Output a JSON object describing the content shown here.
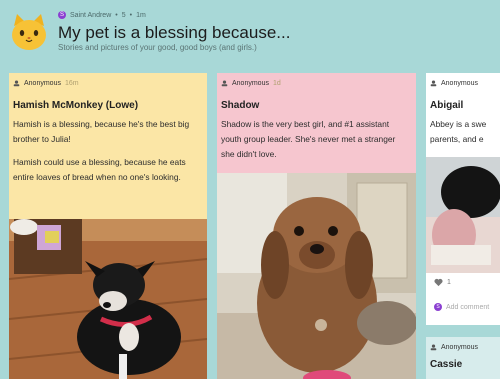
{
  "header": {
    "author": "Saint Andrew",
    "author_initial": "S",
    "likes": "5",
    "age": "1m",
    "title": "My pet is a blessing because...",
    "subtitle": "Stories and pictures of your good, good boys (and girls.)"
  },
  "posts": [
    {
      "author": "Anonymous",
      "time": "16m",
      "title": "Hamish McMonkey (Lowe)",
      "body": [
        "Hamish is a blessing, because he's the best big brother to Julia!",
        "Hamish could use a blessing, because he eats entire loaves of bread when no one's looking."
      ]
    },
    {
      "author": "Anonymous",
      "time": "1d",
      "title": "Shadow",
      "body": [
        "Shadow is the very best girl, and #1 assistant youth group leader. She's never met a stranger she didn't love."
      ]
    },
    {
      "author": "Anonymous",
      "time": "",
      "title": "Abigail",
      "body": [
        "Abbey is a swe parents, and e"
      ],
      "likes": "1",
      "comment_initial": "S",
      "comment_placeholder": "Add comment"
    },
    {
      "author": "Anonymous",
      "time": "",
      "title": "Cassie"
    }
  ],
  "colors": {
    "background": "#a8d8d7",
    "card_yellow": "#fbe6a6",
    "card_pink": "#f6c6cf",
    "accent_purple": "#8b3fd1"
  }
}
